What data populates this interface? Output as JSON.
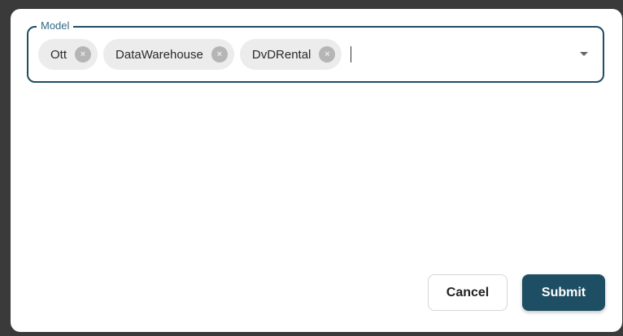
{
  "field": {
    "label": "Model",
    "chips": [
      {
        "label": "Ott",
        "remove_icon": "×"
      },
      {
        "label": "DataWarehouse",
        "remove_icon": "×"
      },
      {
        "label": "DvDRental",
        "remove_icon": "×"
      }
    ],
    "dropdown_icon": "chevron-down-icon"
  },
  "actions": {
    "cancel_label": "Cancel",
    "submit_label": "Submit"
  },
  "colors": {
    "accent": "#1e4e63",
    "label": "#2f6a86",
    "chip_bg": "#ececec"
  }
}
